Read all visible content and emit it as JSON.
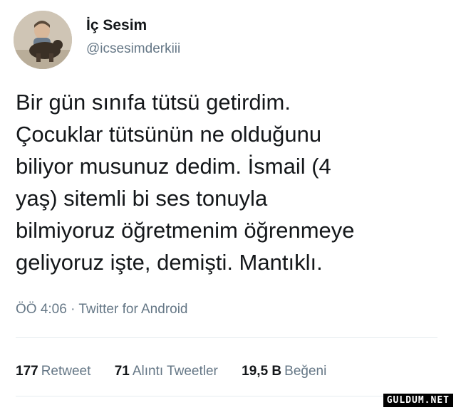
{
  "profile": {
    "name": "İç Sesim",
    "handle": "@icsesimderkiii"
  },
  "tweet": {
    "text": "Bir gün sınıfa tütsü getirdim.\nÇocuklar tütsünün ne olduğunu\nbiliyor musunuz dedim. İsmail (4\nyaş) sitemli bi ses tonuyla\nbilmiyoruz öğretmenim öğrenmeye\ngeliyoruz işte, demişti. Mantıklı.",
    "time": "ÖÖ 4:06",
    "source": "Twitter for Android"
  },
  "stats": {
    "retweets_count": "177",
    "retweets_label": "Retweet",
    "quotes_count": "71",
    "quotes_label": "Alıntı Tweetler",
    "likes_count": "19,5 B",
    "likes_label": "Beğeni"
  },
  "watermark": "GULDUM.NET",
  "colors": {
    "text": "#14171a",
    "secondary": "#657786",
    "divider": "#e6ecf0"
  }
}
